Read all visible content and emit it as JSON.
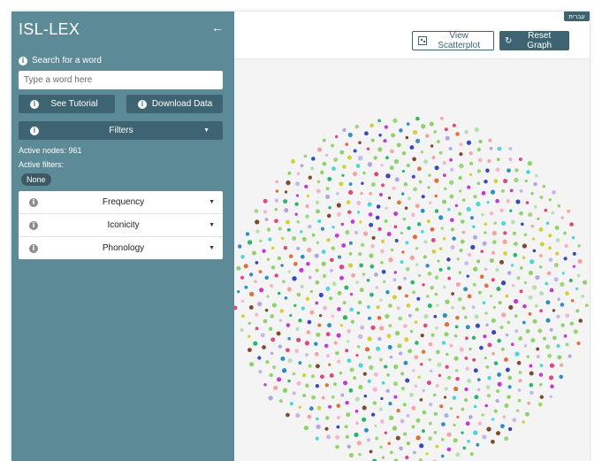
{
  "sidebar": {
    "title": "ISL-LEX",
    "collapse_icon": "arrow-left-icon",
    "search_label": "Search for a word",
    "search_placeholder": "Type a word here",
    "tutorial_button": "See Tutorial",
    "download_button": "Download Data",
    "filters_button": "Filters",
    "active_nodes": "Active nodes: 961",
    "active_filters_label": "Active filters:",
    "active_filters_value": "None",
    "filter_items": [
      "Frequency",
      "Iconicity",
      "Phonology"
    ]
  },
  "header": {
    "scatter_button": "View Scatterplot",
    "reset_button": "Reset Graph",
    "reset_icon": "refresh-icon",
    "language_button": "עברית"
  },
  "graph": {
    "node_count": 961,
    "palette": [
      "#8fd16a",
      "#8fd16a",
      "#8fd16a",
      "#8fd16a",
      "#9ed47a",
      "#9ed47a",
      "#c6b9e8",
      "#b4a6e0",
      "#f2b7cf",
      "#7f4a2e",
      "#e0477d",
      "#d1d13a",
      "#2fb46d",
      "#2f8fbf",
      "#3a4bb8",
      "#e06f3c",
      "#c43ad0",
      "#4bd6d8",
      "#b8dfb0",
      "#f5a3a3"
    ],
    "colors": {
      "sidebar": "#5c8a96",
      "button": "#3d6470",
      "background": "#f4f4f4"
    }
  }
}
